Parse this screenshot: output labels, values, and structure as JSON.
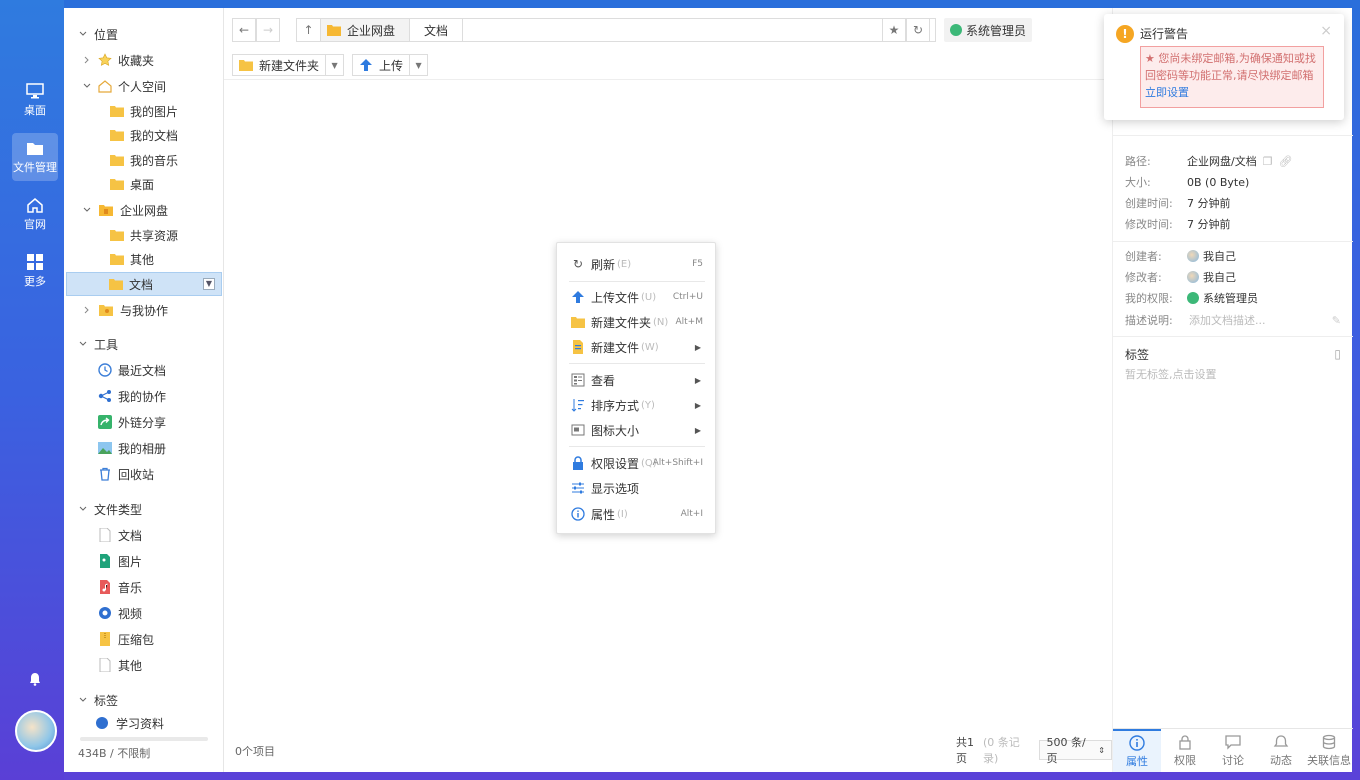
{
  "rail": {
    "items": [
      {
        "label": "桌面",
        "icon": "monitor-icon"
      },
      {
        "label": "文件管理",
        "icon": "folder-icon",
        "active": true
      },
      {
        "label": "官网",
        "icon": "home-icon"
      },
      {
        "label": "更多",
        "icon": "grid-icon"
      }
    ]
  },
  "tree": {
    "location": "位置",
    "favorites": "收藏夹",
    "personal": "个人空间",
    "my_pictures": "我的图片",
    "my_documents": "我的文档",
    "my_music": "我的音乐",
    "desktop": "桌面",
    "enterprise": "企业网盘",
    "shared": "共享资源",
    "other": "其他",
    "documents": "文档",
    "collab_with_me": "与我协作",
    "tools": "工具",
    "recent": "最近文档",
    "my_collab": "我的协作",
    "external_share": "外链分享",
    "my_album": "我的相册",
    "recycle": "回收站",
    "file_types": "文件类型",
    "ft_docs": "文档",
    "ft_images": "图片",
    "ft_music": "音乐",
    "ft_video": "视频",
    "ft_archive": "压缩包",
    "ft_other": "其他",
    "tags": "标签",
    "tag_study": "学习资料",
    "footer": "434B / 不限制"
  },
  "address": {
    "crumb1": "企业网盘",
    "crumb2": "文档",
    "admin": "系统管理员"
  },
  "toolbar": {
    "new_folder": "新建文件夹",
    "upload": "上传"
  },
  "status": {
    "items": "0个项目",
    "pages_prefix": "共1页",
    "pages_records": "(0 条记录)",
    "per_page": "500 条/页"
  },
  "context_menu": {
    "refresh": "刷新",
    "refresh_key": "(E)",
    "refresh_sc": "F5",
    "upload": "上传文件",
    "upload_key": "(U)",
    "upload_sc": "Ctrl+U",
    "new_folder": "新建文件夹",
    "new_folder_key": "(N)",
    "new_folder_sc": "Alt+M",
    "new_file": "新建文件",
    "new_file_key": "(W)",
    "view": "查看",
    "sort": "排序方式",
    "sort_key": "(Y)",
    "icon_size": "图标大小",
    "permission": "权限设置",
    "permission_key": "(Q)",
    "permission_sc": "Alt+Shift+I",
    "display": "显示选项",
    "properties": "属性",
    "properties_key": "(I)",
    "properties_sc": "Alt+I"
  },
  "props": {
    "path_k": "路径:",
    "path_v": "企业网盘/文档",
    "size_k": "大小:",
    "size_v": "0B (0 Byte)",
    "created_k": "创建时间:",
    "created_v": "7 分钟前",
    "modified_k": "修改时间:",
    "modified_v": "7 分钟前",
    "creator_k": "创建者:",
    "creator_v": "我自己",
    "modifier_k": "修改者:",
    "modifier_v": "我自己",
    "perm_k": "我的权限:",
    "perm_v": "系统管理员",
    "desc_k": "描述说明:",
    "desc_placeholder": "添加文档描述...",
    "tags_title": "标签",
    "tags_empty": "暂无标签,点击设置",
    "tabs": [
      "属性",
      "权限",
      "讨论",
      "动态",
      "关联信息"
    ]
  },
  "toast": {
    "title": "运行警告",
    "body": "★ 您尚未绑定邮箱,为确保通知或找回密码等功能正常,请尽快绑定邮箱",
    "link": "立即设置"
  }
}
